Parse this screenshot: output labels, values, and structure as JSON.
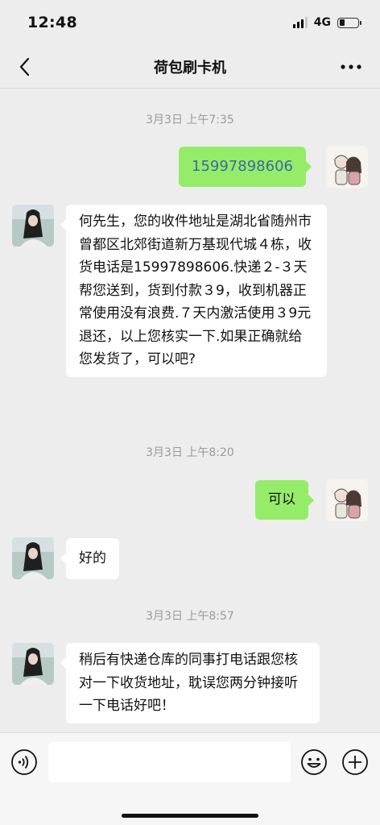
{
  "status_bar": {
    "time": "12:48",
    "network": "4G"
  },
  "header": {
    "title": "荷包刷卡机"
  },
  "messages": [
    {
      "type": "timestamp",
      "text": "3月3日 上午7:35"
    },
    {
      "type": "out",
      "text": "15997898606"
    },
    {
      "type": "in",
      "text": "何先生，您的收件地址是湖北省随州市曾都区北郊街道新万基现代城４栋，收货电话是15997898606.快递２-３天帮您送到，货到付款３9，收到机器正常使用没有浪费.７天内激活使用３9元退还，以上您核实一下.如果正确就给您发货了，可以吧?"
    },
    {
      "type": "timestamp",
      "text": "3月3日 上午8:20"
    },
    {
      "type": "out",
      "text": "可以"
    },
    {
      "type": "in",
      "text": "好的"
    },
    {
      "type": "timestamp",
      "text": "3月3日 上午8:57"
    },
    {
      "type": "in",
      "text": "稍后有快递仓库的同事打电话跟您核对一下收货地址，耽误您两分钟接听一下电话好吧！"
    }
  ],
  "icons": {
    "back": "chevron-left-icon",
    "more": "more-dots-icon",
    "voice": "voice-icon",
    "emoji": "emoji-icon",
    "plus": "plus-icon"
  },
  "colors": {
    "outgoing_bubble": "#95ec69",
    "incoming_bubble": "#ffffff",
    "background": "#ededed",
    "link_number": "#3b6a9e"
  }
}
